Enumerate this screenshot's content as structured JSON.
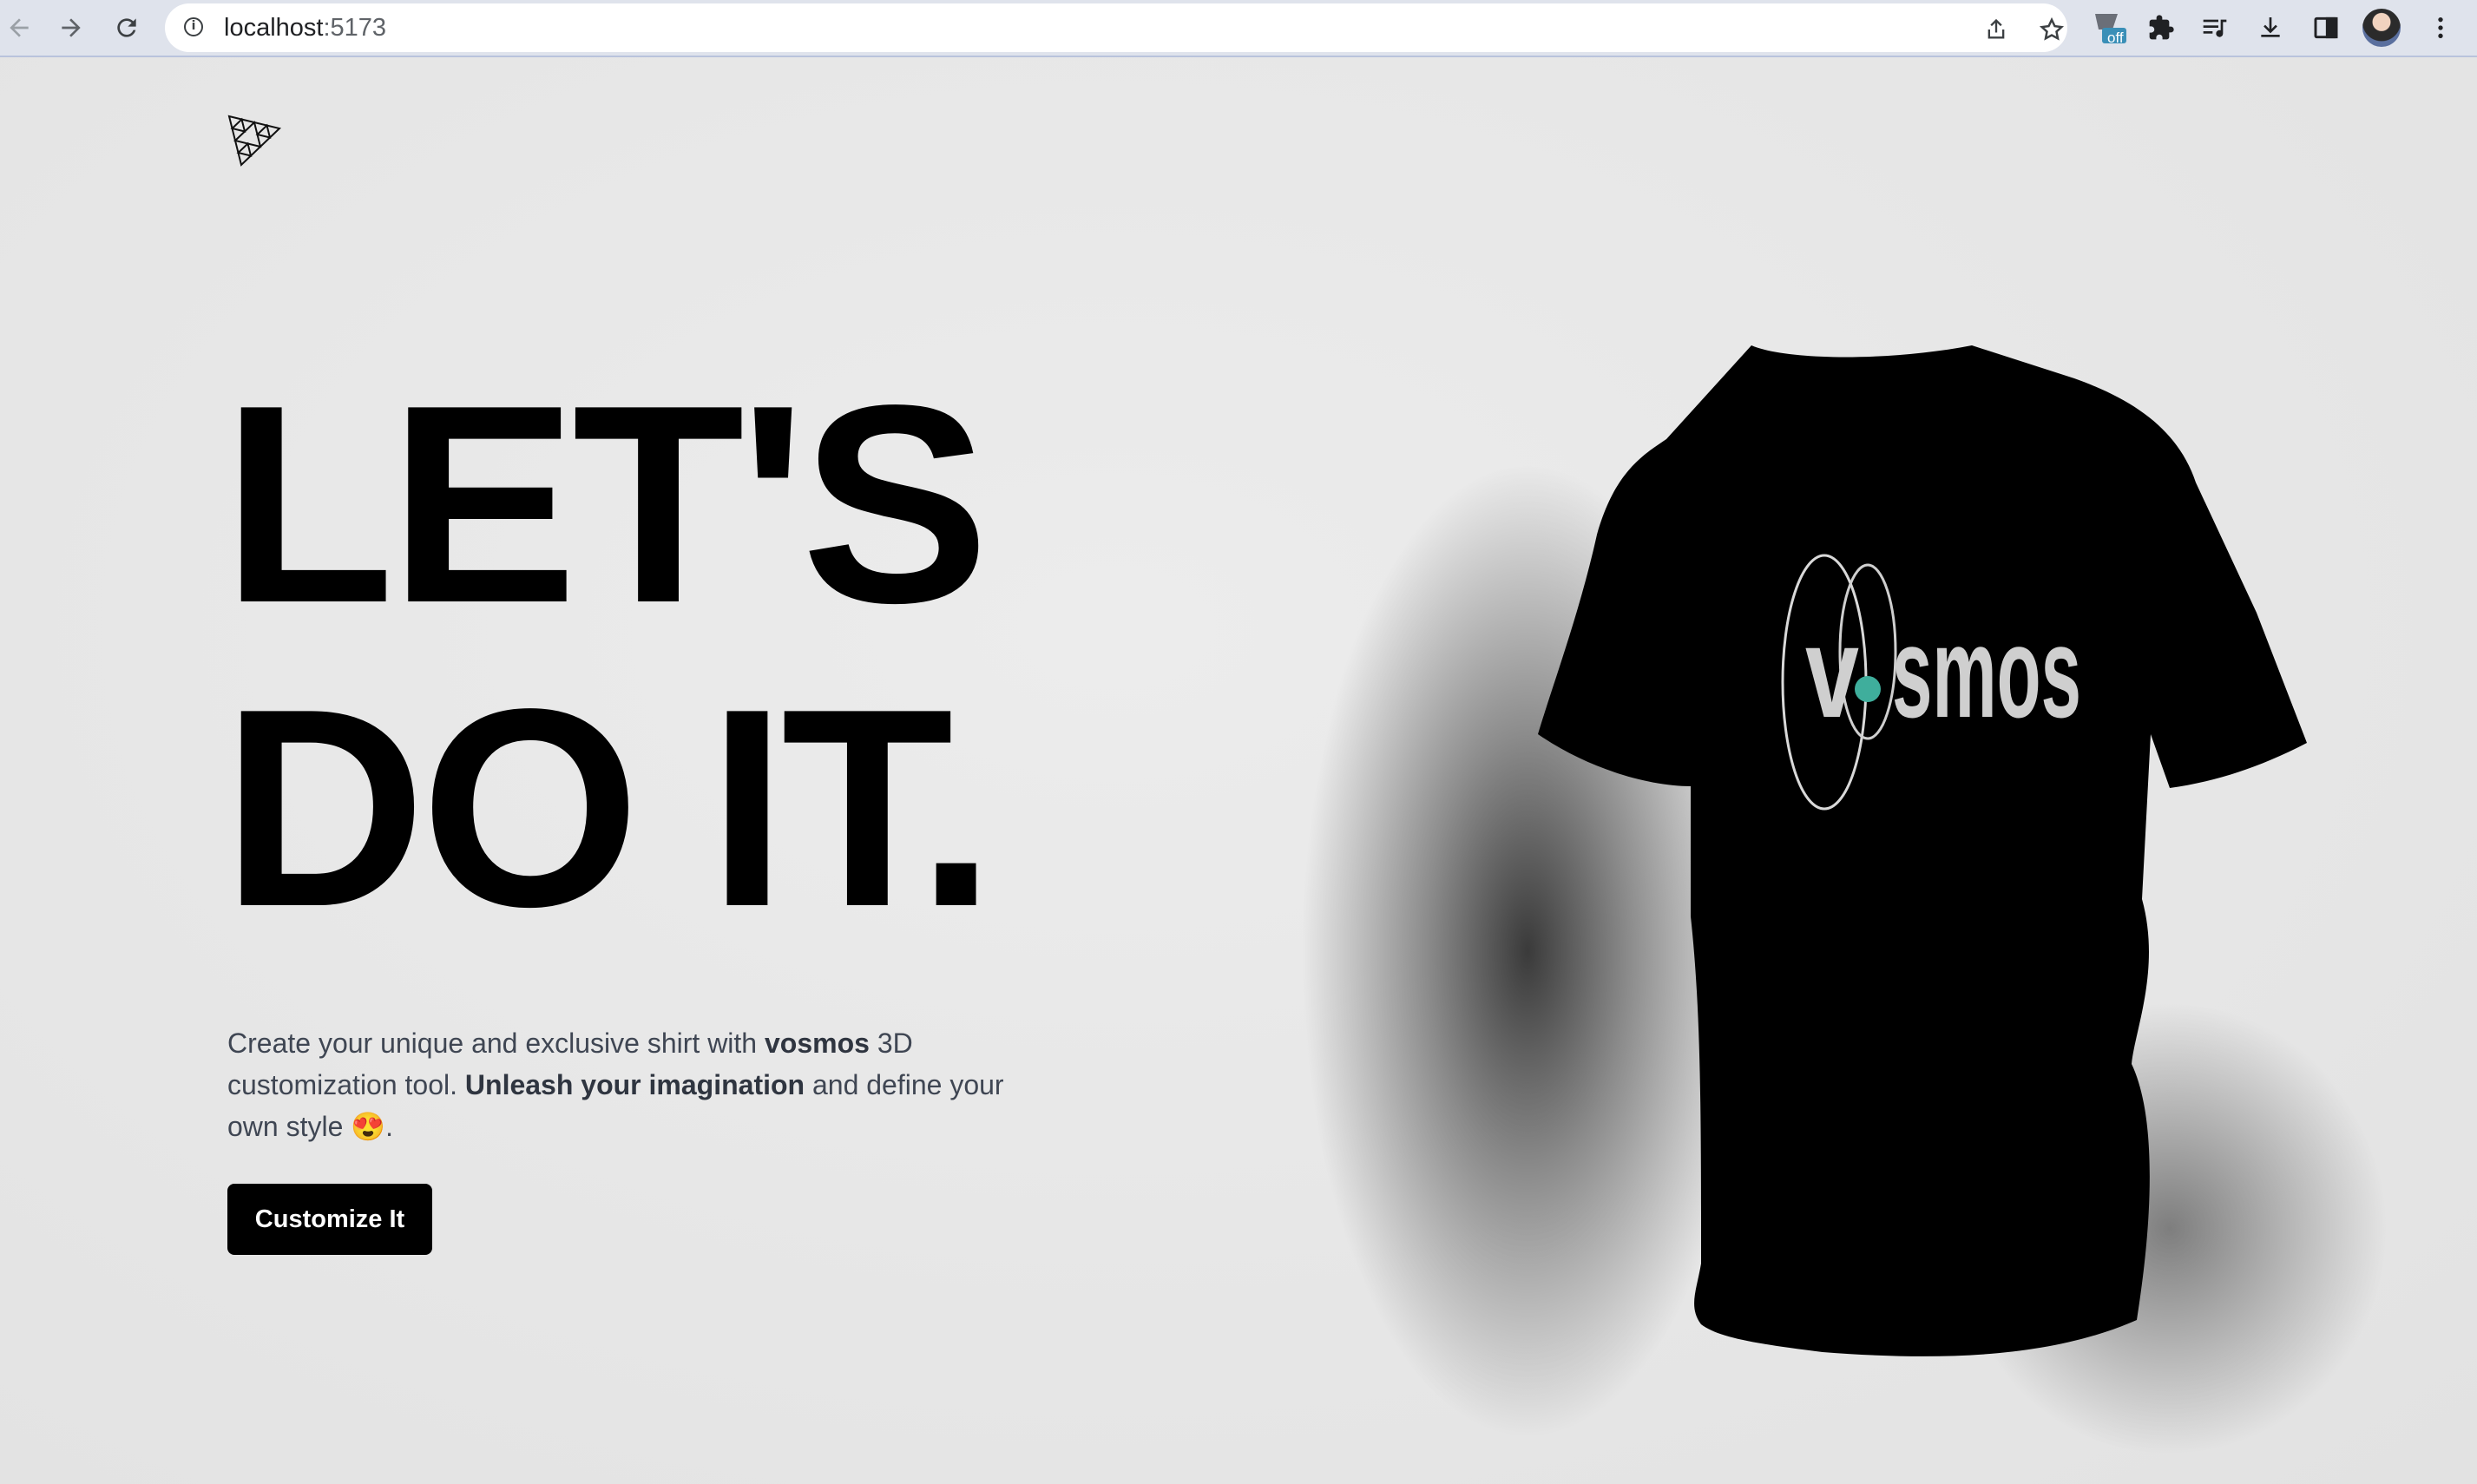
{
  "browser": {
    "url_host": "localhost",
    "url_port": ":5173",
    "extension_badge": "off"
  },
  "hero": {
    "headline_line1": "LET'S",
    "headline_line2": "DO IT.",
    "desc_part1": "Create your unique and exclusive shirt with ",
    "desc_brand": "vosmos",
    "desc_part2": " 3D customization tool. ",
    "desc_bold": "Unleash your imagination",
    "desc_part3": " and define your own style ",
    "desc_emoji": "😍",
    "desc_end": ".",
    "cta_label": "Customize It"
  },
  "shirt": {
    "color": "#000000",
    "logo_text": "vosmos",
    "logo_accent_color": "#3fae9c"
  },
  "icons": [
    "back-arrow-icon",
    "forward-arrow-icon",
    "reload-icon",
    "info-icon",
    "share-icon",
    "star-icon",
    "extension-badge-icon",
    "puzzle-icon",
    "media-icon",
    "download-icon",
    "side-panel-icon",
    "profile-avatar",
    "more-menu-icon",
    "threejs-logo-icon"
  ]
}
